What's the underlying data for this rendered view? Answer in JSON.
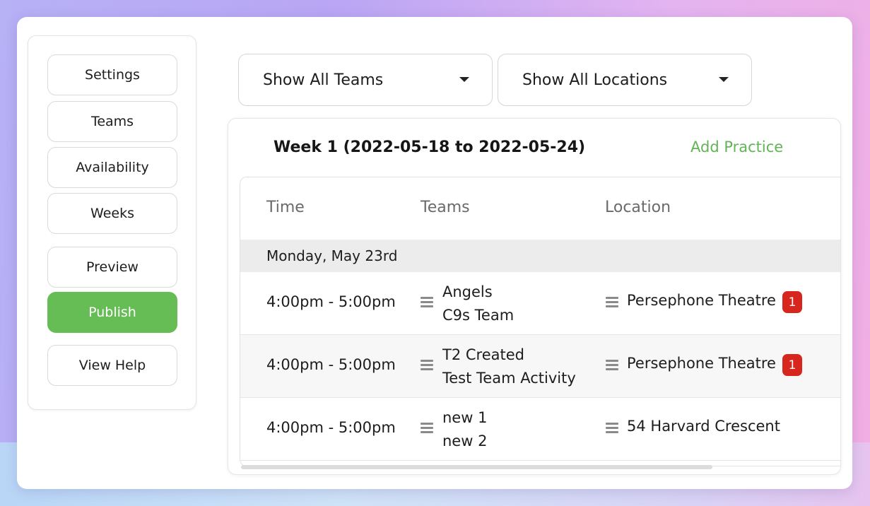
{
  "sidebar": {
    "items": [
      {
        "label": "Settings"
      },
      {
        "label": "Teams"
      },
      {
        "label": "Availability"
      },
      {
        "label": "Weeks"
      },
      {
        "label": "Preview"
      },
      {
        "label": "Publish",
        "primary": true
      },
      {
        "label": "View Help"
      }
    ]
  },
  "filters": {
    "teams": "Show All Teams",
    "locations": "Show All Locations"
  },
  "week": {
    "title": "Week 1 (2022-05-18 to 2022-05-24)",
    "add_practice": "Add Practice"
  },
  "table": {
    "headers": {
      "time": "Time",
      "teams": "Teams",
      "location": "Location"
    },
    "day": "Monday, May 23rd",
    "rows": [
      {
        "time": "4:00pm - 5:00pm",
        "teams": [
          "Angels",
          "C9s Team"
        ],
        "location": "Persephone Theatre",
        "badge": "1"
      },
      {
        "time": "4:00pm - 5:00pm",
        "teams": [
          "T2 Created",
          "Test Team Activity"
        ],
        "location": "Persephone Theatre",
        "badge": "1"
      },
      {
        "time": "4:00pm - 5:00pm",
        "teams": [
          "new 1",
          "new 2"
        ],
        "location": "54 Harvard Crescent",
        "badge": null
      }
    ]
  },
  "colors": {
    "accent_green": "#66bd55",
    "link_green": "#62b457",
    "badge_red": "#d7261e"
  }
}
